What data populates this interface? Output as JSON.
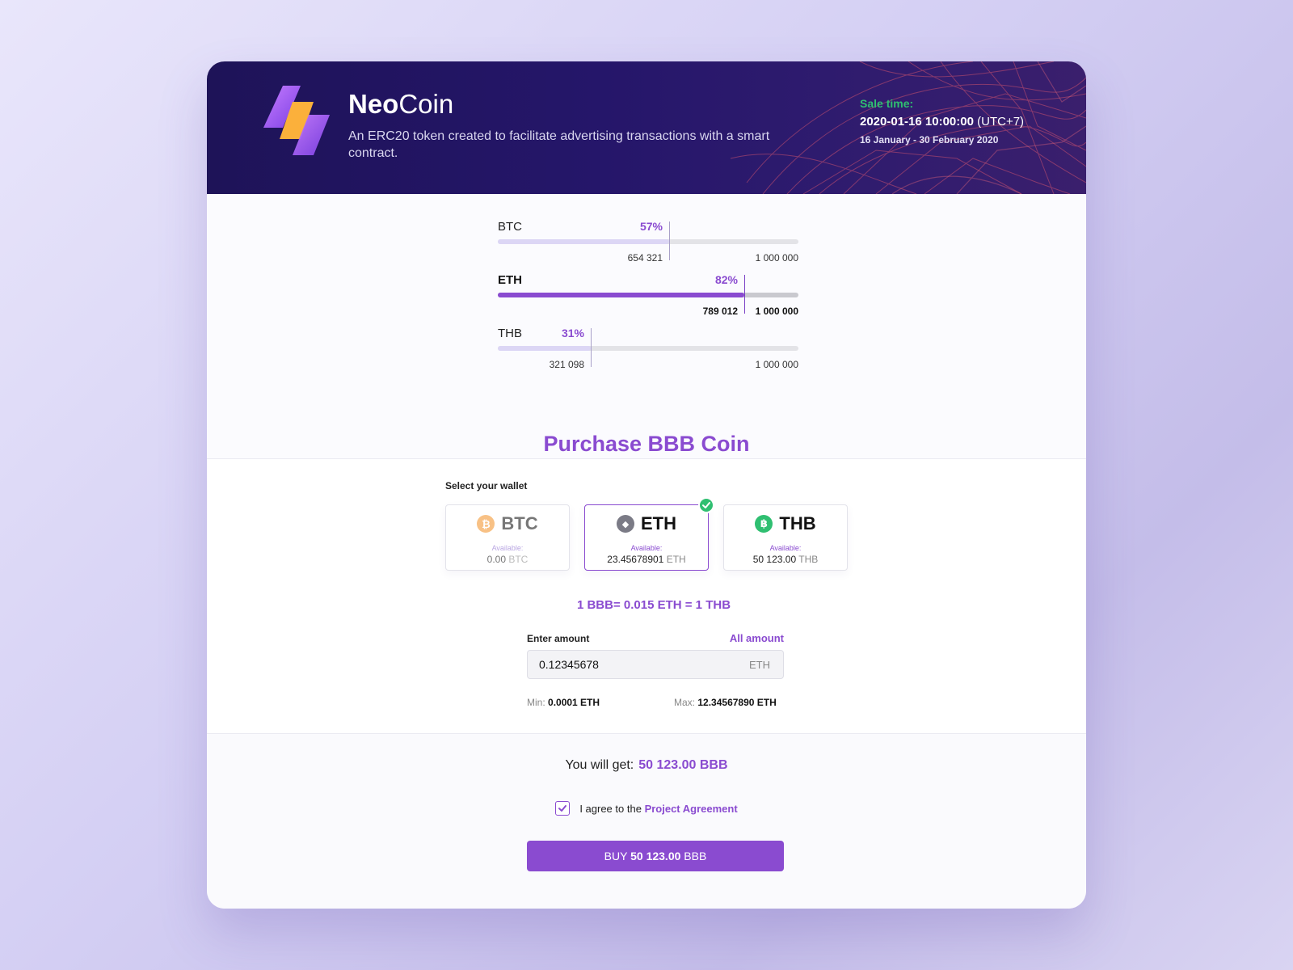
{
  "header": {
    "brand_bold": "Neo",
    "brand_light": "Coin",
    "tagline": "An ERC20 token created to facilitate advertising transactions with a smart contract.",
    "sale_label": "Sale time:",
    "sale_datetime": "2020-01-16 10:00:00",
    "sale_timezone": "(UTC+7)",
    "sale_range": "16 January - 30 February 2020"
  },
  "progress": [
    {
      "currency": "BTC",
      "percent_label": "57%",
      "percent": 57,
      "current": "654 321",
      "max": "1 000 000",
      "active": false
    },
    {
      "currency": "ETH",
      "percent_label": "82%",
      "percent": 82,
      "current": "789 012",
      "max": "1 000 000",
      "active": true
    },
    {
      "currency": "THB",
      "percent_label": "31%",
      "percent": 31,
      "current": "321 098",
      "max": "1 000 000",
      "active": false
    }
  ],
  "purchase": {
    "title": "Purchase BBB Coin",
    "wallet_label": "Select your wallet",
    "wallets": [
      {
        "name": "BTC",
        "symbol": "₿",
        "icon": "bitcoin-icon",
        "color": "#f8c185",
        "available_label": "Available:",
        "balance": "0.00",
        "unit": "BTC",
        "selected": false,
        "disabled": true
      },
      {
        "name": "ETH",
        "symbol": "◆",
        "icon": "ethereum-icon",
        "color": "#7b7b86",
        "available_label": "Available:",
        "balance": "23.45678901",
        "unit": "ETH",
        "selected": true,
        "disabled": false
      },
      {
        "name": "THB",
        "symbol": "฿",
        "icon": "baht-icon",
        "color": "#2fbf71",
        "available_label": "Available:",
        "balance": "50 123.00",
        "unit": "THB",
        "selected": false,
        "disabled": false
      }
    ],
    "rate": "1 BBB= 0.015 ETH = 1 THB",
    "amount_label": "Enter amount",
    "all_amount": "All amount",
    "amount_value": "0.12345678",
    "amount_unit": "ETH",
    "min_label": "Min:",
    "min_value": "0.0001 ETH",
    "max_label": "Max:",
    "max_value": "12.34567890 ETH"
  },
  "summary": {
    "get_label": "You will get:",
    "get_value": "50 123.00 BBB",
    "agree_text": "I agree to the",
    "agree_link": "Project Agreement",
    "agreed": true,
    "buy_prefix": "BUY",
    "buy_amount": "50 123.00",
    "buy_unit": "BBB"
  },
  "colors": {
    "accent": "#8a4bd0",
    "success": "#2fbf71",
    "header_bg": "#1e1358"
  }
}
